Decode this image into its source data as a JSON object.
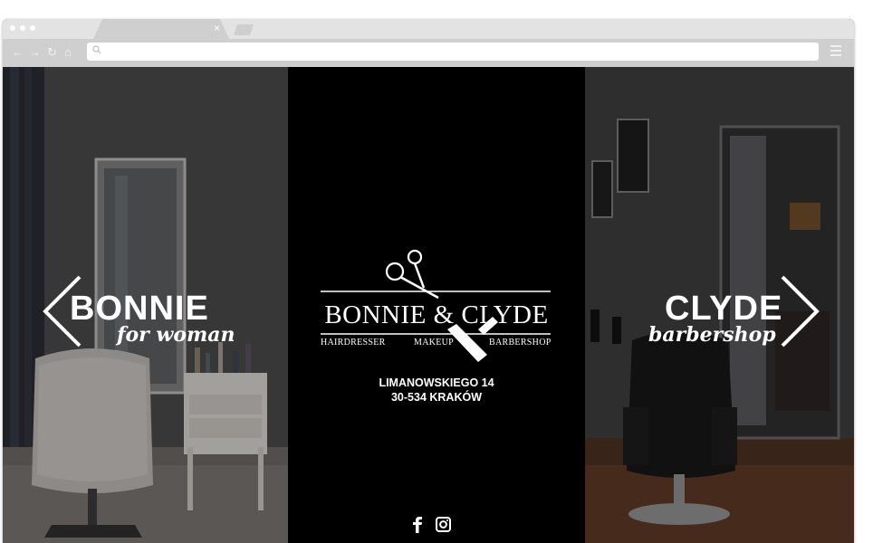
{
  "browser": {
    "tab_close": "×",
    "nav": {
      "back": "←",
      "forward": "→",
      "reload": "↻",
      "home": "⌂"
    },
    "address_icon": "search-icon",
    "menu_icon": "hamburger-menu-icon"
  },
  "left_panel": {
    "title": "BONNIE",
    "subtitle": "for woman"
  },
  "center": {
    "brand": "BONNIE & CLYDE",
    "services": [
      "HAIRDRESSER",
      "MAKEUP",
      "BARBERSHOP"
    ],
    "address_line1": "LIMANOWSKIEGO 14",
    "address_line2": "30-534 KRAKÓW",
    "social_icons": [
      "facebook-icon",
      "instagram-icon"
    ]
  },
  "right_panel": {
    "title": "CLYDE",
    "subtitle": "barbershop"
  },
  "colors": {
    "chrome": "#cfcfcf",
    "chrome_tabs": "#e3e3e3",
    "center_bg": "#000000",
    "text": "#ffffff"
  }
}
